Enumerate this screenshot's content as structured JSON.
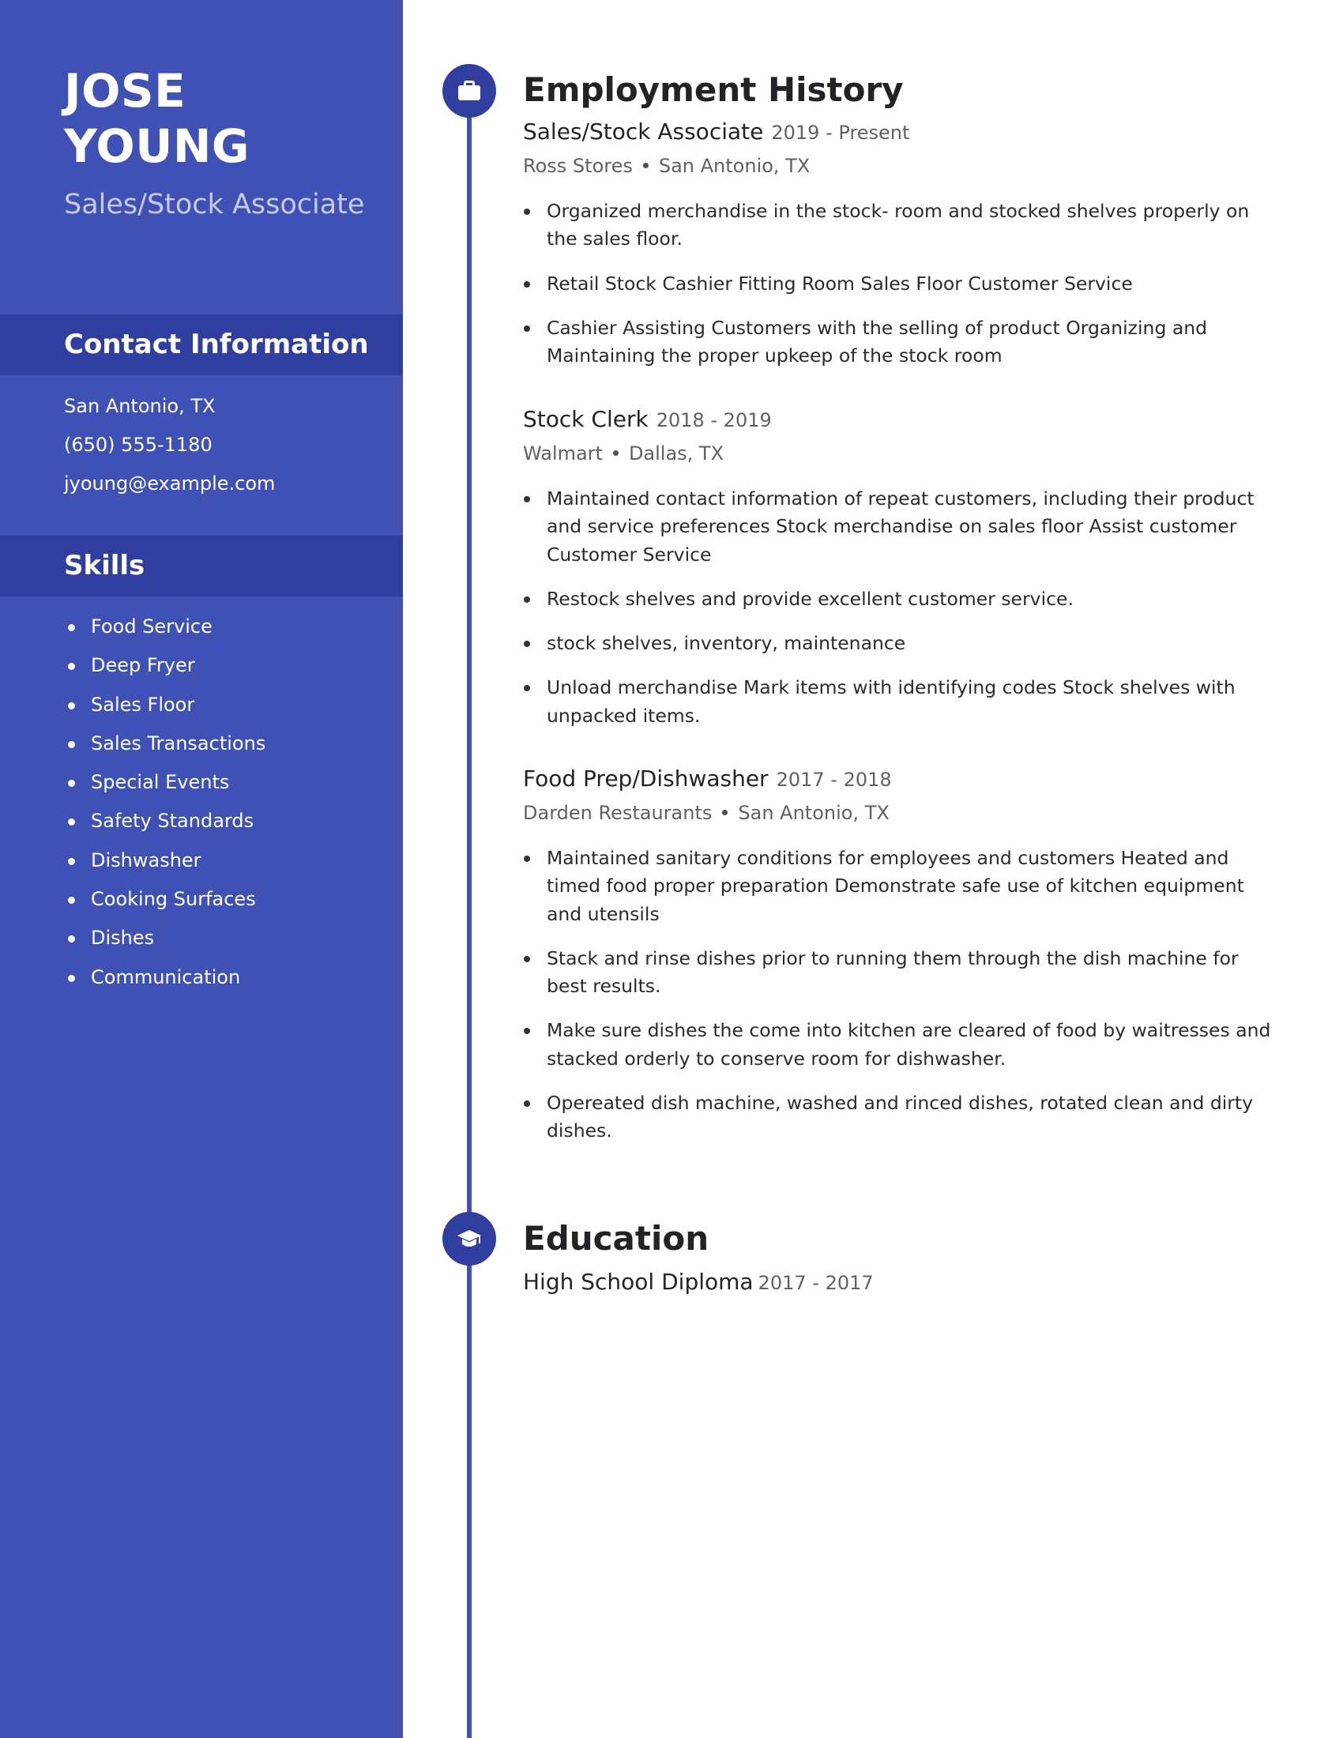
{
  "profile": {
    "first_name": "JOSE",
    "last_name": "YOUNG",
    "headline": "Sales/Stock Associate"
  },
  "contact": {
    "heading": "Contact Information",
    "location": "San Antonio, TX",
    "phone": "(650) 555-1180",
    "email": "jyoung@example.com"
  },
  "skills": {
    "heading": "Skills",
    "items": [
      "Food Service",
      "Deep Fryer",
      "Sales Floor",
      "Sales Transactions",
      "Special Events",
      "Safety Standards",
      "Dishwasher",
      "Cooking Surfaces",
      "Dishes",
      "Communication"
    ]
  },
  "employment": {
    "heading": "Employment History",
    "icon": "briefcase-icon",
    "jobs": [
      {
        "title": "Sales/Stock Associate",
        "dates": "2019 - Present",
        "company": "Ross Stores",
        "location": "San Antonio, TX",
        "bullets": [
          "Organized merchandise in the stock- room and stocked shelves properly on the sales floor.",
          "Retail Stock Cashier Fitting Room Sales Floor Customer Service",
          "Cashier Assisting Customers with the selling of product Organizing and Maintaining the proper upkeep of the stock room"
        ]
      },
      {
        "title": "Stock Clerk",
        "dates": "2018 - 2019",
        "company": "Walmart",
        "location": "Dallas, TX",
        "bullets": [
          "Maintained contact information of repeat customers, including their product and service preferences Stock merchandise on sales floor Assist customer Customer Service",
          "Restock shelves and provide excellent customer service.",
          "stock shelves, inventory, maintenance",
          "Unload merchandise Mark items with identifying codes Stock shelves with unpacked items."
        ]
      },
      {
        "title": "Food Prep/Dishwasher",
        "dates": "2017 - 2018",
        "company": "Darden Restaurants",
        "location": "San Antonio, TX",
        "bullets": [
          "Maintained sanitary conditions for employees and customers Heated and timed food proper preparation Demonstrate safe use of kitchen equipment and utensils",
          "Stack and rinse dishes prior to running them through the dish machine for best results.",
          "Make sure dishes the come into kitchen are cleared of food by waitresses and stacked orderly to conserve room for dishwasher.",
          "Opereated dish machine, washed and rinced dishes, rotated clean and dirty dishes."
        ]
      }
    ]
  },
  "education": {
    "heading": "Education",
    "icon": "graduation-cap-icon",
    "entries": [
      {
        "degree": "High School Diploma",
        "dates": "2017 - 2017"
      }
    ]
  },
  "colors": {
    "sidebar": "#3f51b5",
    "sidebar_heading": "#303f9f",
    "timeline": "#3f51b5",
    "text_dark": "#222326",
    "text_muted": "#606060"
  }
}
